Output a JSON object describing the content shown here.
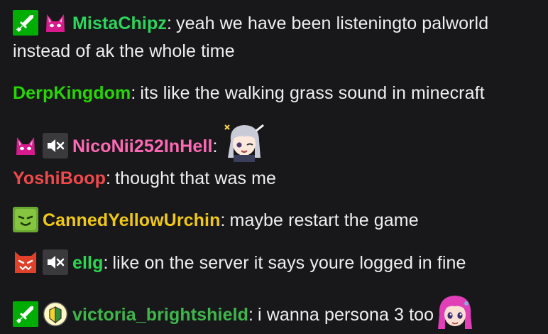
{
  "messages": [
    {
      "badges": [
        "moderator-sword-icon",
        "cat-ears-badge-icon"
      ],
      "username": "MistaChipz",
      "username_color": "#2cd65b",
      "separator": ":",
      "text": "yeah we have been listeningto palworld instead of ak the whole time"
    },
    {
      "badges": [],
      "username": "DerpKingdom",
      "username_color": "#27d600",
      "separator": ":",
      "text": "its like the walking grass sound in minecraft"
    },
    {
      "badges": [
        "cat-ears-badge-icon",
        "muted-speaker-icon"
      ],
      "username": "NicoNii252InHell",
      "username_color": "#ff69b4",
      "separator": ":",
      "text": "",
      "emotes": [
        "anime-girl-salute-emote"
      ]
    },
    {
      "badges": [],
      "username": "YoshiBoop",
      "username_color": "#f0494b",
      "separator": ":",
      "text": "thought that was me"
    },
    {
      "badges": [
        "green-smiley-badge-icon"
      ],
      "username": "CannedYellowUrchin",
      "username_color": "#f0c814",
      "separator": ":",
      "text": "maybe restart the game"
    },
    {
      "badges": [
        "red-devil-badge-icon",
        "muted-speaker-icon"
      ],
      "username": "ellg",
      "username_color": "#2bd64f",
      "separator": ":",
      "text": "like on the server it says youre logged in fine"
    },
    {
      "badges": [
        "moderator-sword-icon",
        "beginner-leaf-badge-icon"
      ],
      "username": "victoria_brightshield",
      "username_color": "#3fb64a",
      "separator": ":",
      "text": "i wanna persona 3 too",
      "emotes": [
        "pink-hair-anime-emote"
      ]
    }
  ],
  "colors": {
    "background": "#18181b",
    "message_text": "#efeff1",
    "moderator_badge": "#00ad03"
  }
}
